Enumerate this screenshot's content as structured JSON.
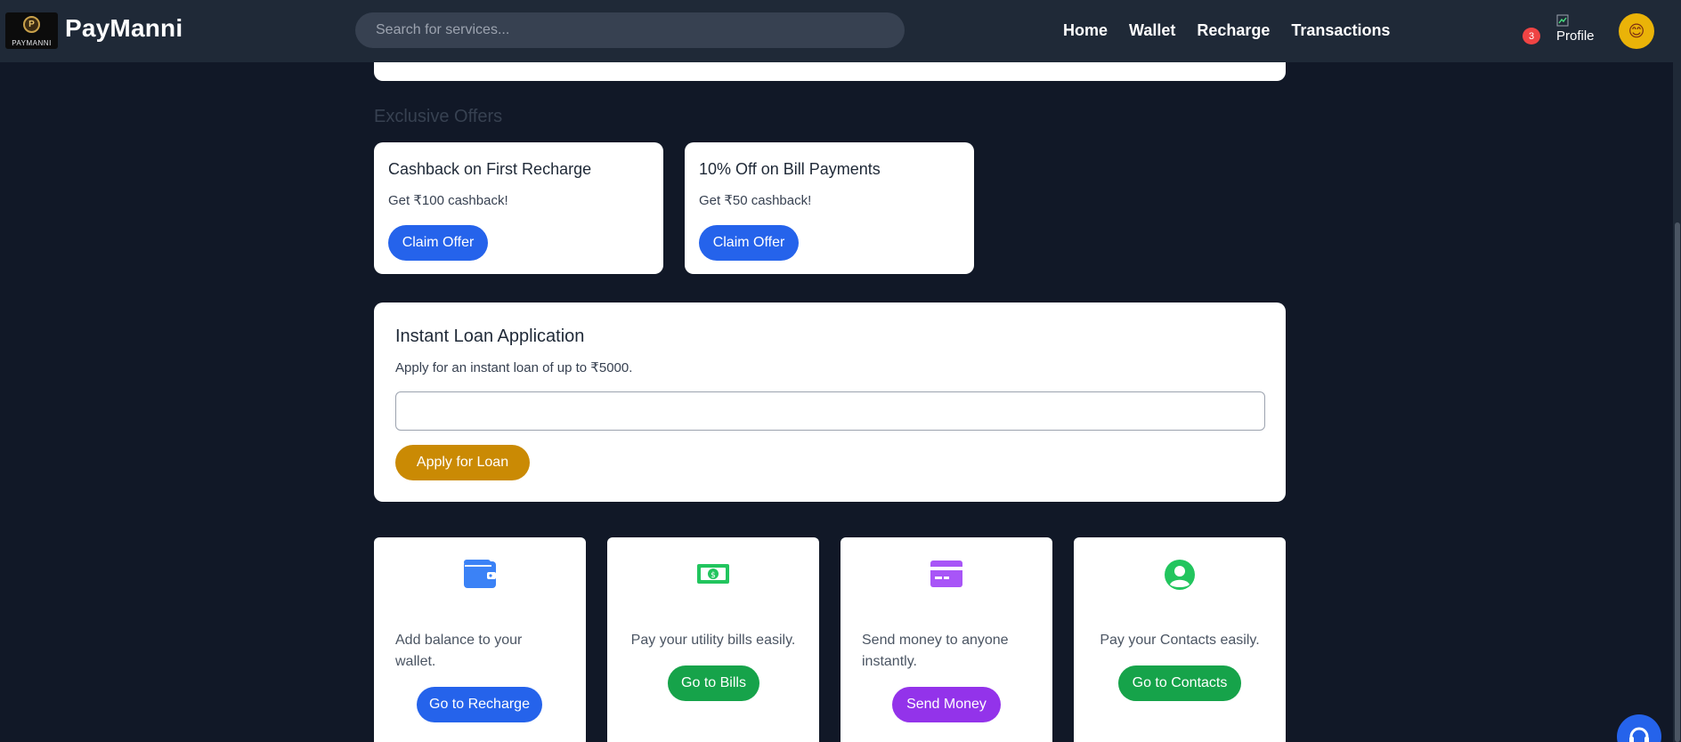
{
  "navbar": {
    "logo_letter": "P",
    "logo_text": "PAYMANNI",
    "brand": "PayManni",
    "search_placeholder": "Search for services...",
    "links": [
      "Home",
      "Wallet",
      "Recharge",
      "Transactions"
    ],
    "notification_count": "3",
    "profile_alt": "Profile",
    "avatar_emoji": "😊"
  },
  "offers": {
    "title": "Exclusive Offers",
    "items": [
      {
        "title": "Cashback on First Recharge",
        "desc": "Get ₹100 cashback!",
        "button": "Claim Offer"
      },
      {
        "title": "10% Off on Bill Payments",
        "desc": "Get ₹50 cashback!",
        "button": "Claim Offer"
      }
    ]
  },
  "loan": {
    "title": "Instant Loan Application",
    "desc": "Apply for an instant loan of up to ₹5000.",
    "input_value": "",
    "button": "Apply for Loan"
  },
  "features": [
    {
      "icon": "wallet-icon",
      "desc": "Add balance to your wallet.",
      "button": "Go to Recharge",
      "color": "#2563eb"
    },
    {
      "icon": "money-bill-icon",
      "desc": "Pay your utility bills easily.",
      "button": "Go to Bills",
      "color": "#16a34a"
    },
    {
      "icon": "credit-card-icon",
      "desc": "Send money to anyone instantly.",
      "button": "Send Money",
      "color": "#9333ea"
    },
    {
      "icon": "user-circle-icon",
      "desc": "Pay your Contacts easily.",
      "button": "Go to Contacts",
      "color": "#16a34a"
    }
  ],
  "colors": {
    "background": "#111827",
    "navbar": "#1f2937",
    "primary": "#2563eb",
    "loan_button": "#ca8a04",
    "notification": "#ef4444"
  }
}
